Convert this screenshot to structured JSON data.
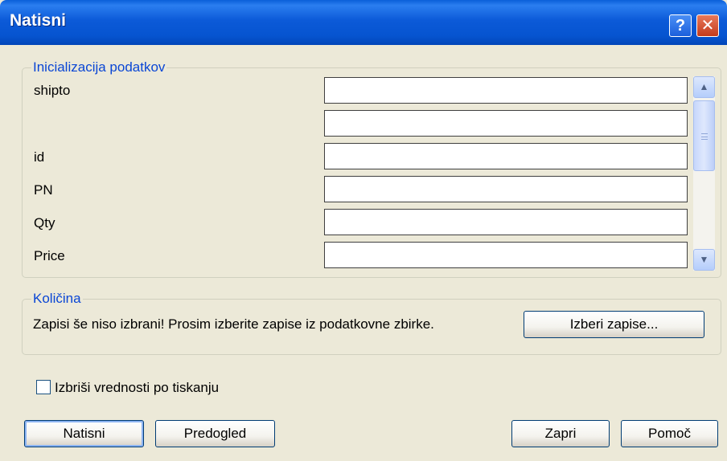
{
  "window": {
    "title": "Natisni"
  },
  "titlebar_buttons": {
    "help": "?",
    "close": "✕"
  },
  "data_group": {
    "legend": "Inicializacija podatkov",
    "rows": [
      {
        "label": "shipto",
        "value": ""
      },
      {
        "label": "",
        "value": ""
      },
      {
        "label": "id",
        "value": ""
      },
      {
        "label": "PN",
        "value": ""
      },
      {
        "label": "Qty",
        "value": ""
      },
      {
        "label": "Price",
        "value": ""
      }
    ]
  },
  "quantity_group": {
    "legend": "Količina",
    "message": "Zapisi še niso izbrani! Prosim izberite zapise iz podatkovne zbirke.",
    "select_button": "Izberi zapise..."
  },
  "clear_checkbox": {
    "label": "Izbriši vrednosti po tiskanju",
    "checked": false
  },
  "buttons": {
    "print": "Natisni",
    "preview": "Predogled",
    "close": "Zapri",
    "help": "Pomoč"
  }
}
